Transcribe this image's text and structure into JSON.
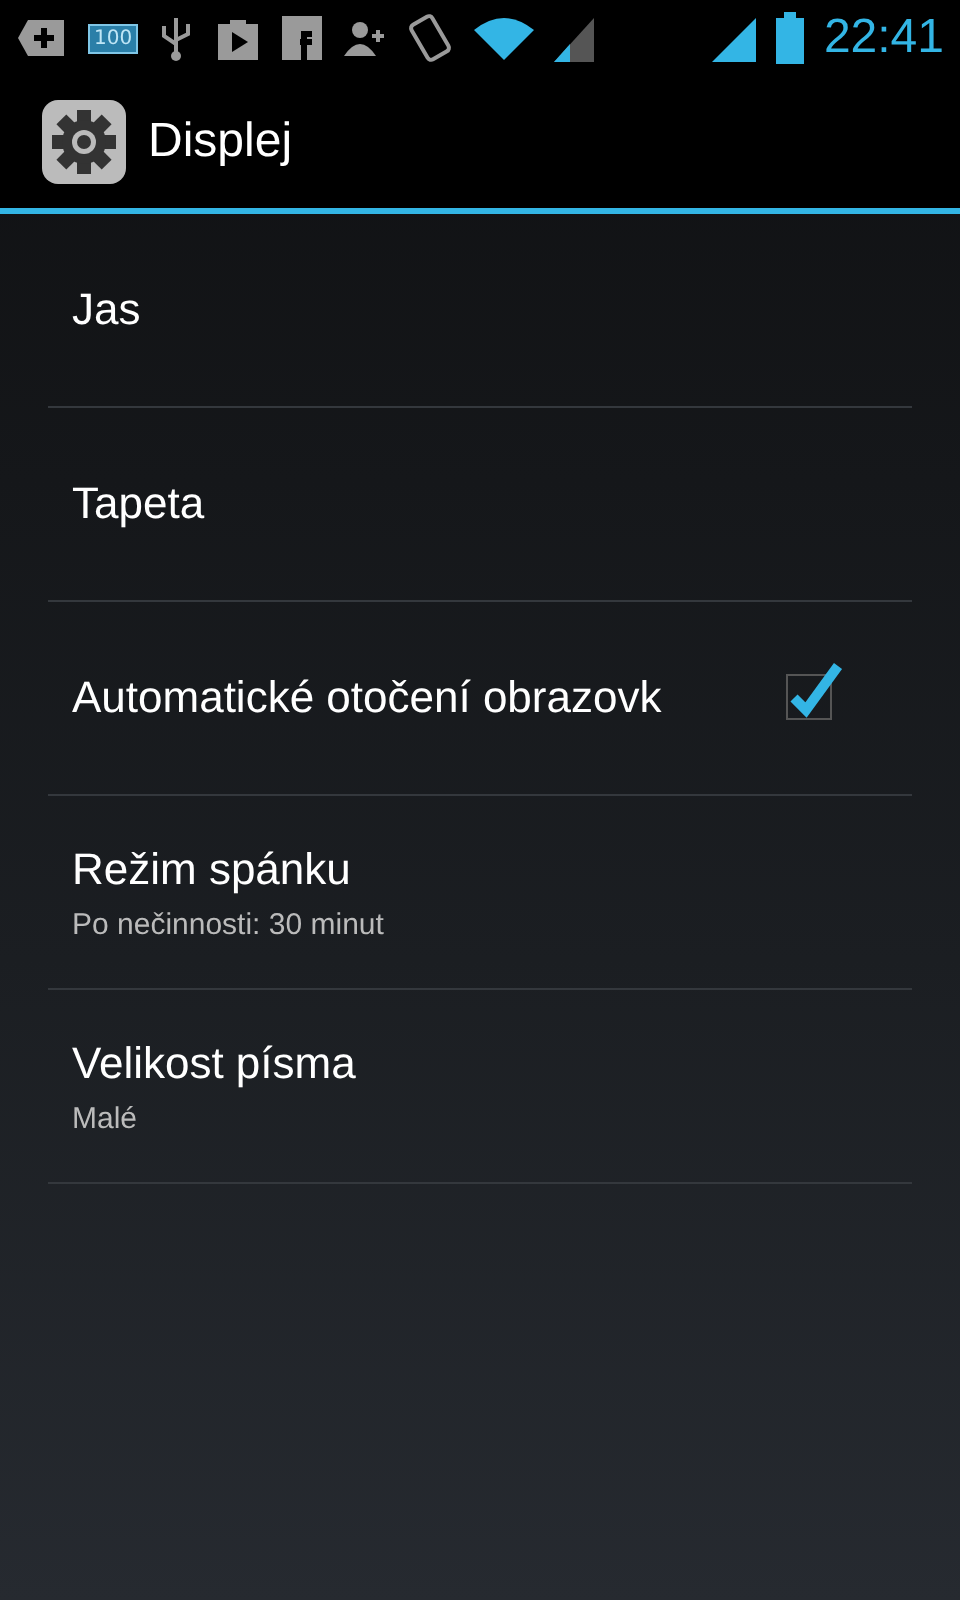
{
  "status_bar": {
    "badge": "100",
    "time": "22:41"
  },
  "action_bar": {
    "title": "Displej"
  },
  "items": [
    {
      "kind": "plain",
      "title": "Jas"
    },
    {
      "kind": "plain",
      "title": "Tapeta"
    },
    {
      "kind": "checkbox",
      "title": "Automatické otočení obrazovk",
      "checked": true
    },
    {
      "kind": "plain",
      "title": "Režim spánku",
      "summary": "Po nečinnosti: 30 minut"
    },
    {
      "kind": "plain",
      "title": "Velikost písma",
      "summary": "Malé"
    }
  ]
}
